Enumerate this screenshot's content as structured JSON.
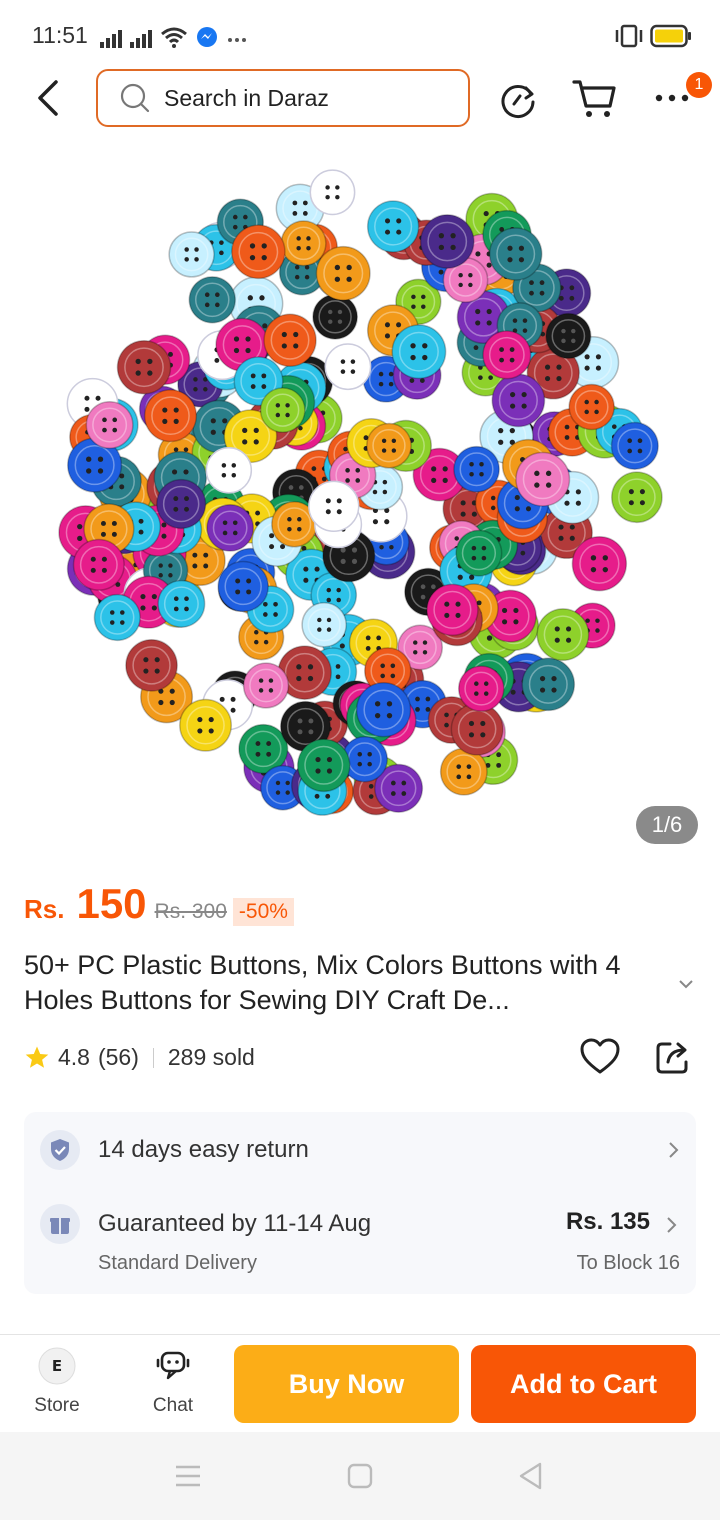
{
  "status": {
    "time": "11:51"
  },
  "search": {
    "placeholder": "Search in Daraz"
  },
  "cart": {
    "badge": "1"
  },
  "gallery": {
    "counter": "1/6"
  },
  "price": {
    "currency": "Rs.",
    "current": "150",
    "original": "Rs. 300",
    "discount": "-50%"
  },
  "product": {
    "title": "50+ PC Plastic Buttons, Mix Colors Buttons with 4 Holes Buttons for Sewing DIY Craft De..."
  },
  "rating": {
    "score": "4.8",
    "count": "(56)",
    "sold": "289 sold"
  },
  "services": {
    "returns": "14 days easy return",
    "delivery_title": "Guaranteed by 11-14 Aug",
    "delivery_type": "Standard Delivery",
    "delivery_price": "Rs. 135",
    "delivery_location": "To Block 16"
  },
  "bottom": {
    "store": "Store",
    "chat": "Chat",
    "buy_now": "Buy Now",
    "add_to_cart": "Add to Cart"
  },
  "colors": {
    "accent": "#f85606",
    "buy_now": "#fcad17"
  }
}
